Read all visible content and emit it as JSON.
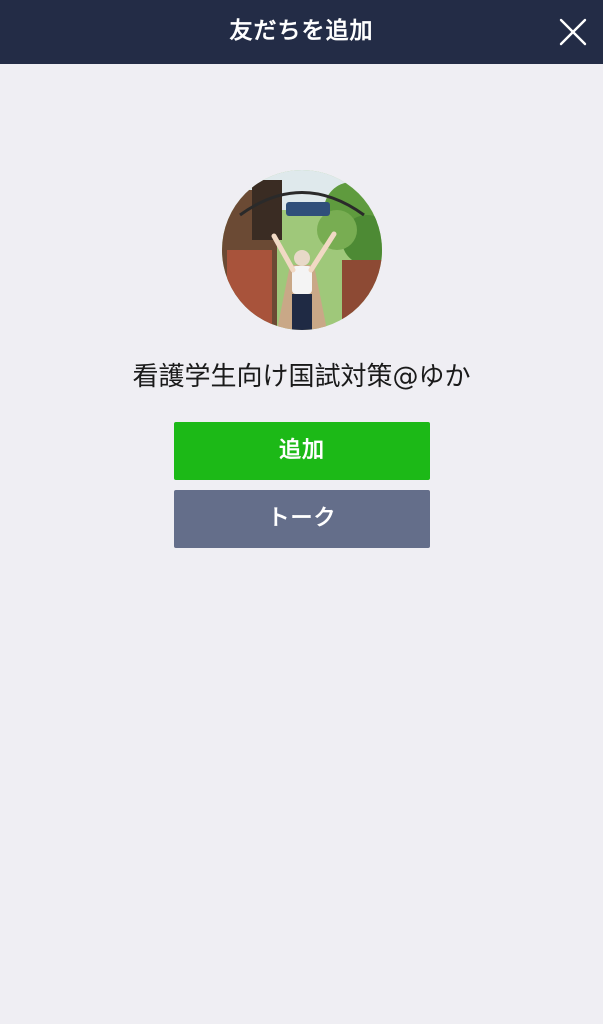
{
  "header": {
    "title": "友だちを追加",
    "close_icon": "close-icon"
  },
  "profile": {
    "avatar_icon": "profile-photo",
    "name": "看護学生向け国試対策@ゆか"
  },
  "actions": {
    "add_label": "追加",
    "talk_label": "トーク"
  },
  "colors": {
    "header_bg": "#232c46",
    "page_bg": "#efeef3",
    "add_button": "#1cb917",
    "talk_button": "#646e8a"
  }
}
